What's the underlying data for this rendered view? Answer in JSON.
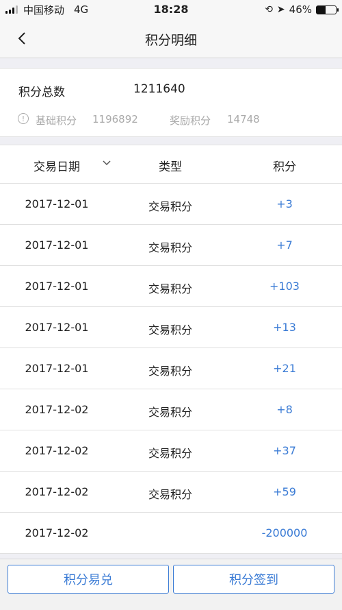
{
  "status_bar": {
    "carrier": "中国移动",
    "network": "4G",
    "time": "18:28",
    "battery": "46%",
    "battery_level": 0.46
  },
  "nav": {
    "title": "积分明细"
  },
  "summary": {
    "total_label": "积分总数",
    "total_value": "1211640",
    "base_label": "基础积分",
    "base_value": "1196892",
    "bonus_label": "奖励积分",
    "bonus_value": "14748"
  },
  "table": {
    "headers": {
      "date": "交易日期",
      "type": "类型",
      "points": "积分"
    },
    "rows": [
      {
        "date": "2017-12-01",
        "type": "交易积分",
        "points": "+3"
      },
      {
        "date": "2017-12-01",
        "type": "交易积分",
        "points": "+7"
      },
      {
        "date": "2017-12-01",
        "type": "交易积分",
        "points": "+103"
      },
      {
        "date": "2017-12-01",
        "type": "交易积分",
        "points": "+13"
      },
      {
        "date": "2017-12-01",
        "type": "交易积分",
        "points": "+21"
      },
      {
        "date": "2017-12-02",
        "type": "交易积分",
        "points": "+8"
      },
      {
        "date": "2017-12-02",
        "type": "交易积分",
        "points": "+37"
      },
      {
        "date": "2017-12-02",
        "type": "交易积分",
        "points": "+59"
      },
      {
        "date": "2017-12-02",
        "type": "",
        "points": "-200000"
      }
    ]
  },
  "bottom": {
    "exchange_label": "积分易兑",
    "signin_label": "积分签到"
  },
  "colors": {
    "accent": "#3a7bd5",
    "muted": "#aaaaaa",
    "background": "#efeff4"
  },
  "icons": {
    "back": "chevron-left-icon",
    "sort": "chevron-down-icon",
    "info": "info-icon",
    "location": "location-arrow-icon",
    "lock": "rotation-lock-icon"
  }
}
